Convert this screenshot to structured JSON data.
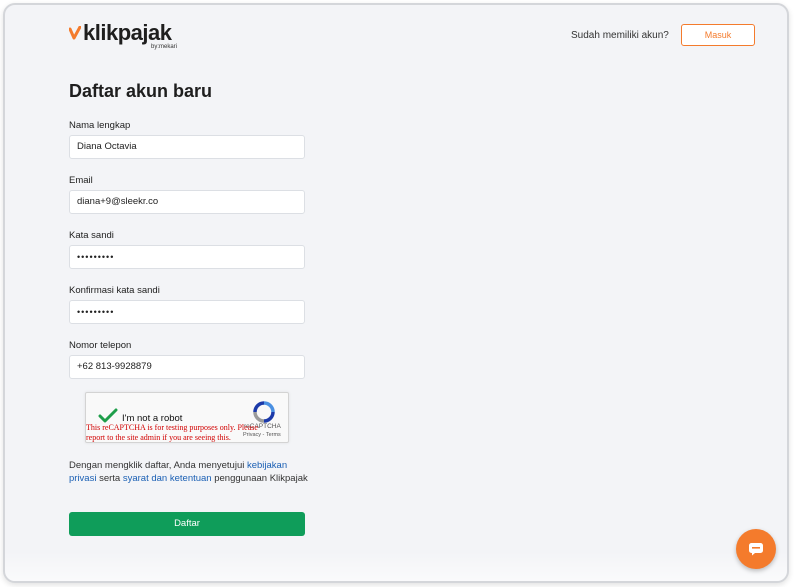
{
  "brand": {
    "name": "klikpajak",
    "sub": "by:mekari",
    "accent_color": "#f47b2c",
    "primary_color": "#0f9d5a"
  },
  "header": {
    "have_account_text": "Sudah memiliki akun?",
    "login_label": "Masuk"
  },
  "form": {
    "title": "Daftar akun baru",
    "fields": [
      {
        "label": "Nama lengkap",
        "value": "Diana Octavia"
      },
      {
        "label": "Email",
        "value": "diana+9@sleekr.co"
      },
      {
        "label": "Kata sandi",
        "value": "•••••••••"
      },
      {
        "label": "Konfirmasi kata sandi",
        "value": "•••••••••"
      },
      {
        "label": "Nomor telepon",
        "value": "+62  813-9928879"
      }
    ],
    "submit_label": "Daftar"
  },
  "captcha": {
    "label": "I'm not a robot",
    "brand": "reCAPTCHA",
    "links": "Privacy - Terms",
    "warning": "This reCAPTCHA is for testing purposes only. Please report to the site admin if you are seeing this."
  },
  "terms": {
    "prefix": "Dengan mengklik daftar, Anda menyetujui ",
    "privacy_link": "kebijakan privasi",
    "middle": " serta ",
    "terms_link": "syarat dan ketentuan",
    "suffix": " penggunaan Klikpajak"
  },
  "chat": {
    "icon": "chat-icon"
  }
}
